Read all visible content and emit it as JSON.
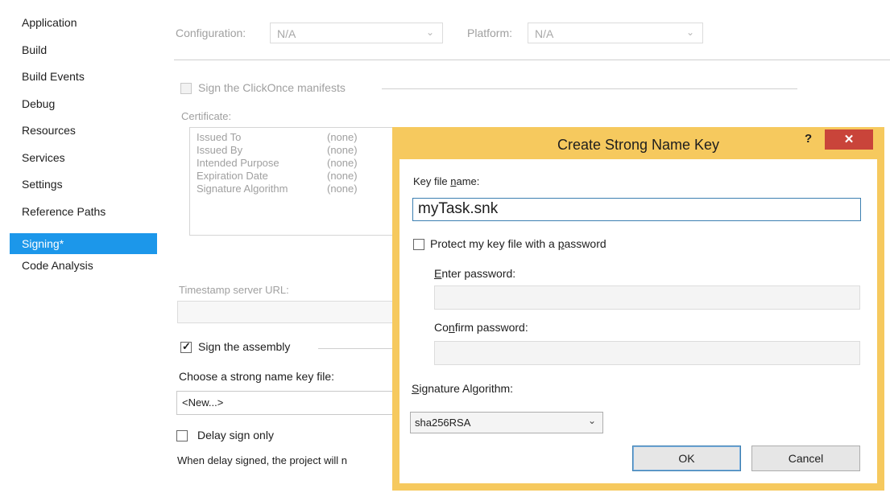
{
  "sidebar": {
    "items": [
      {
        "label": "Application"
      },
      {
        "label": "Build"
      },
      {
        "label": "Build Events"
      },
      {
        "label": "Debug"
      },
      {
        "label": "Resources"
      },
      {
        "label": "Services"
      },
      {
        "label": "Settings"
      },
      {
        "label": "Reference Paths"
      },
      {
        "label": "Signing*"
      },
      {
        "label": "Code Analysis"
      }
    ]
  },
  "header": {
    "configuration_label": "Configuration:",
    "configuration_value": "N/A",
    "platform_label": "Platform:",
    "platform_value": "N/A"
  },
  "signing": {
    "clickonce_label": "Sign the ClickOnce manifests",
    "certificate_label": "Certificate:",
    "cert_fields": [
      {
        "name": "Issued To",
        "value": "(none)"
      },
      {
        "name": "Issued By",
        "value": "(none)"
      },
      {
        "name": "Intended Purpose",
        "value": "(none)"
      },
      {
        "name": "Expiration Date",
        "value": "(none)"
      },
      {
        "name": "Signature Algorithm",
        "value": "(none)"
      }
    ],
    "timestamp_label": "Timestamp server URL:",
    "sign_assembly_label": "Sign the assembly",
    "sign_assembly_checked": true,
    "key_file_label": "Choose a strong name key file:",
    "key_file_value": "<New...>",
    "delay_sign_label": "Delay sign only",
    "delay_note": "When delay signed, the project will n"
  },
  "dialog": {
    "title": "Create Strong Name Key",
    "help": "?",
    "close": "✕",
    "key_file_name_label_pre": "Key file ",
    "key_file_name_label_u": "n",
    "key_file_name_label_post": "ame:",
    "key_file_name_value": "myTask.snk",
    "protect_pre": "Protect my key file with a ",
    "protect_u": "p",
    "protect_post": "assword",
    "enter_pw_u": "E",
    "enter_pw_post": "nter password:",
    "confirm_pw_pre": "Co",
    "confirm_pw_u": "n",
    "confirm_pw_post": "firm password:",
    "sig_alg_u": "S",
    "sig_alg_post": "ignature Algorithm:",
    "sig_alg_value": "sha256RSA",
    "ok_label": "OK",
    "cancel_label": "Cancel"
  },
  "colors": {
    "accent": "#1c97ea",
    "dialog_border": "#f6c95e",
    "close": "#c9443a"
  }
}
